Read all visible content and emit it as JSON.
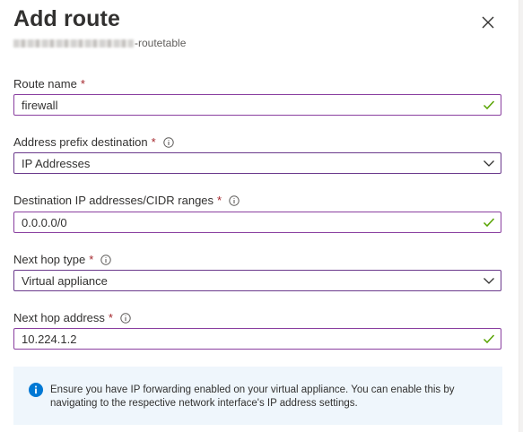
{
  "header": {
    "title": "Add route",
    "subtitle_suffix": "-routetable"
  },
  "form": {
    "route_name": {
      "label": "Route name",
      "required_mark": "*",
      "value": "firewall"
    },
    "address_prefix": {
      "label": "Address prefix destination",
      "required_mark": "*",
      "value": "IP Addresses"
    },
    "destination_ips": {
      "label": "Destination IP addresses/CIDR ranges",
      "required_mark": "*",
      "value": "0.0.0.0/0"
    },
    "next_hop_type": {
      "label": "Next hop type",
      "required_mark": "*",
      "value": "Virtual appliance"
    },
    "next_hop_address": {
      "label": "Next hop address",
      "required_mark": "*",
      "value": "10.224.1.2"
    }
  },
  "notice": {
    "text": "Ensure you have IP forwarding enabled on your virtual appliance. You can enable this by navigating to the respective network interface's IP address settings."
  },
  "colors": {
    "required": "#a4262c",
    "valid_check": "#57a300",
    "info_blue": "#0078d4",
    "notice_bg": "#eff6fc",
    "input_border": "#8a3fa0"
  },
  "icons": {
    "close": "close-icon",
    "info": "info-icon",
    "check": "check-icon",
    "chevron": "chevron-down-icon"
  }
}
